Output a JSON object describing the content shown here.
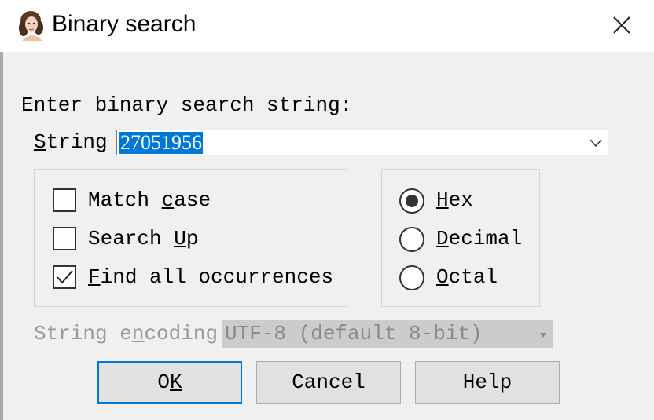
{
  "window": {
    "title": "Binary search"
  },
  "prompt": "Enter binary search string:",
  "string_field": {
    "label_pre": "",
    "label_u": "S",
    "label_post": "tring",
    "value": "27051956"
  },
  "options": [
    {
      "pre": "Match ",
      "u": "c",
      "post": "ase",
      "checked": false
    },
    {
      "pre": "Search ",
      "u": "U",
      "post": "p",
      "checked": false
    },
    {
      "pre": "",
      "u": "F",
      "post": "ind all occurrences",
      "checked": true
    }
  ],
  "radix": [
    {
      "pre": "",
      "u": "H",
      "post": "ex",
      "selected": true
    },
    {
      "pre": "",
      "u": "D",
      "post": "ecimal",
      "selected": false
    },
    {
      "pre": "",
      "u": "O",
      "post": "ctal",
      "selected": false
    }
  ],
  "encoding": {
    "pre": "String e",
    "u": "n",
    "post": "coding",
    "value": "UTF-8 (default 8-bit)"
  },
  "buttons": {
    "ok": {
      "pre": "O",
      "u": "K",
      "post": ""
    },
    "cancel": {
      "pre": "Cancel",
      "u": "",
      "post": ""
    },
    "help": {
      "pre": "Help",
      "u": "",
      "post": ""
    }
  },
  "icons": {
    "app": "portrait-icon",
    "close": "close-icon"
  }
}
